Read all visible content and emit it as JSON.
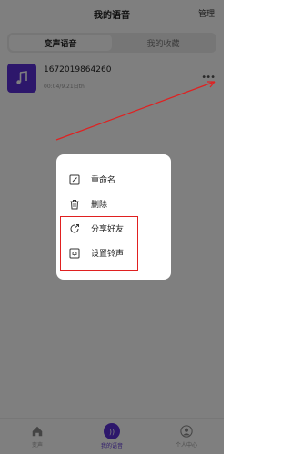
{
  "header": {
    "title": "我的语音",
    "action_label": "管理"
  },
  "tabs": [
    {
      "label": "变声语音",
      "active": true
    },
    {
      "label": "我的收藏",
      "active": false
    }
  ],
  "recording": {
    "title": "1672019864260",
    "date": "00:04/9.21日th",
    "thumb_icon": "music-note-icon",
    "more_icon": "more-dots-icon"
  },
  "menu": {
    "items": [
      {
        "label": "重命名",
        "icon": "edit-icon"
      },
      {
        "label": "删除",
        "icon": "trash-icon"
      },
      {
        "label": "分享好友",
        "icon": "share-icon"
      },
      {
        "label": "设置铃声",
        "icon": "ringtone-icon"
      }
    ]
  },
  "bottom_nav": {
    "items": [
      {
        "label": "变声",
        "icon": "home-icon",
        "active": false
      },
      {
        "label": "我的语音",
        "icon": "voice-icon",
        "active": true
      },
      {
        "label": "个人中心",
        "icon": "user-icon",
        "active": false
      }
    ]
  },
  "colors": {
    "accent": "#5a2fd6",
    "annotation": "#e02020",
    "overlay": "rgba(0,0,0,0.5)"
  }
}
